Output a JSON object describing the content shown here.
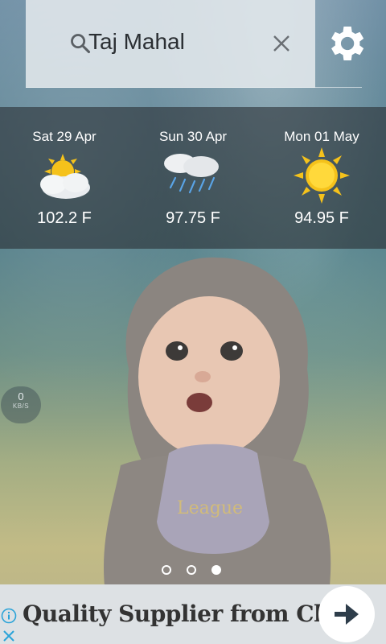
{
  "search": {
    "query": "Taj Mahal"
  },
  "forecast": [
    {
      "date": "Sat 29 Apr",
      "temp": "102.2 F",
      "icon": "partly-cloudy-icon"
    },
    {
      "date": "Sun 30 Apr",
      "temp": "97.75 F",
      "icon": "rain-icon"
    },
    {
      "date": "Mon 01 May",
      "temp": "94.95 F",
      "icon": "sunny-icon"
    }
  ],
  "network": {
    "value": "0",
    "unit": "KB/S"
  },
  "pager": {
    "count": 3,
    "active": 3
  },
  "ad": {
    "headline": "Quality Supplier from China."
  },
  "colors": {
    "sun": "#f5c21b",
    "ad_bg": "#dde1e4",
    "text_light": "#ffffff"
  }
}
